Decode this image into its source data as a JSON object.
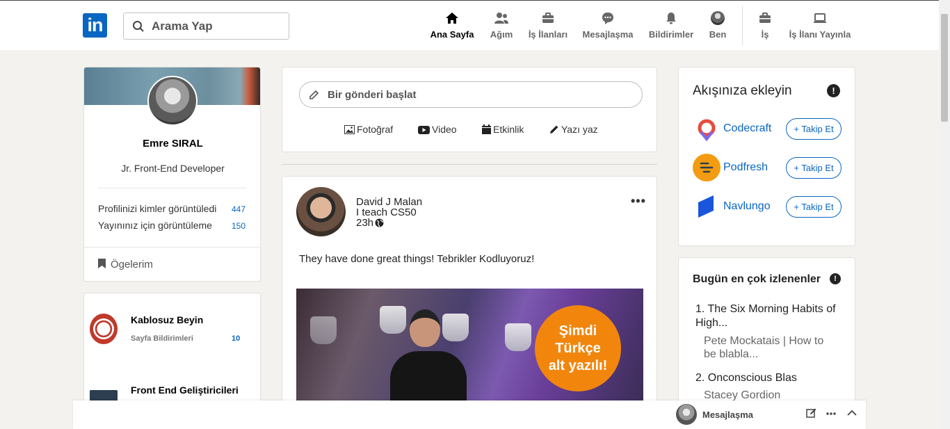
{
  "nav": {
    "search_placeholder": "Arama Yap",
    "items": [
      {
        "label": "Ana Sayfa",
        "icon": "home-icon"
      },
      {
        "label": "Ağım",
        "icon": "network-icon"
      },
      {
        "label": "İş İlanları",
        "icon": "briefcase-icon"
      },
      {
        "label": "Mesajlaşma",
        "icon": "chat-icon"
      },
      {
        "label": "Bildirimler",
        "icon": "bell-icon"
      },
      {
        "label": "Ben",
        "icon": "avatar-icon"
      },
      {
        "label": "İş",
        "icon": "grid-briefcase-icon"
      },
      {
        "label": "İş İlanı Yayınla",
        "icon": "laptop-icon"
      }
    ],
    "logo_text": "in"
  },
  "profile": {
    "name": "Emre SIRAL",
    "title": "Jr. Front-End Developer",
    "stats": [
      {
        "label": "Profilinizi kimler görüntüledi",
        "value": "447"
      },
      {
        "label": "Yayınınız için görüntüleme",
        "value": "150"
      }
    ],
    "saved_label": "Ögelerim"
  },
  "groups": [
    {
      "name": "Kablosuz Beyin",
      "sub": "Sayfa Bildirimleri",
      "count": "10"
    },
    {
      "name": "Front End Geliştiricileri"
    }
  ],
  "composer": {
    "placeholder": "Bir gönderi başlat",
    "actions": [
      "Fotoğraf",
      "Video",
      "Etkinlik",
      "Yazı yaz"
    ]
  },
  "post": {
    "author": "David J Malan",
    "subtitle": "I teach CS50",
    "time": "23h",
    "text": "They have done great things! Tebrikler Kodluyoruz!",
    "badge_lines": [
      "Şimdi",
      "Türkçe",
      "alt yazılı!"
    ],
    "more": "•••"
  },
  "follow": {
    "title": "Akışınıza ekleyin",
    "button_label": "+ Takip Et",
    "companies": [
      "Codecraft",
      "Podfresh",
      "Navlungo"
    ]
  },
  "trending": {
    "title": "Bugün en çok izlenenler",
    "items": [
      {
        "title": "1. The Six Morning Habits of High...",
        "sub": "Pete Mockatais | How to be blabla..."
      },
      {
        "title": "2. Onconscious Blas",
        "sub": "Stacey Gordion"
      }
    ]
  },
  "messaging": {
    "label": "Mesajlaşma"
  },
  "colors": {
    "brand": "#0a66c2",
    "background": "#f3f2ef",
    "badge": "#f2860d"
  }
}
